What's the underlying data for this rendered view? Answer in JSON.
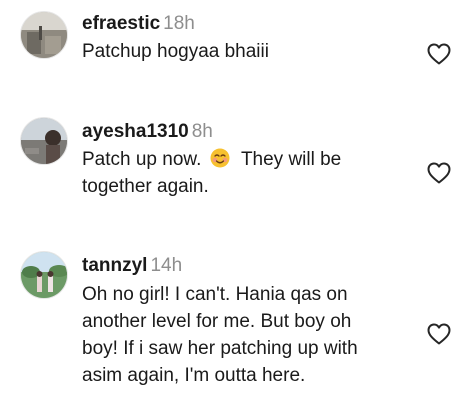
{
  "comments": [
    {
      "username": "efraestic",
      "time": "18h",
      "lines": [
        "Patchup hogyaa bhaiii"
      ],
      "avatar_icon": "user-avatar-boats",
      "like_icon": "heart-outline-icon"
    },
    {
      "username": "ayesha1310",
      "time": "8h",
      "line1_a": "Patch up now.",
      "line1_b": "They will be",
      "line2": "together again.",
      "emoji": "smiling-blush-emoji",
      "avatar_icon": "user-avatar-portrait",
      "like_icon": "heart-outline-icon"
    },
    {
      "username": "tannzyl",
      "time": "14h",
      "lines": [
        "Oh no girl! I can't. Hania qas on",
        "another level for me. But boy oh",
        "boy! If i saw her patching up with",
        "asim again, I'm outta here."
      ],
      "avatar_icon": "user-avatar-park",
      "like_icon": "heart-outline-icon"
    }
  ],
  "colors": {
    "text": "#1a1a1a",
    "muted": "#8e8e8e",
    "icon": "#262626"
  }
}
